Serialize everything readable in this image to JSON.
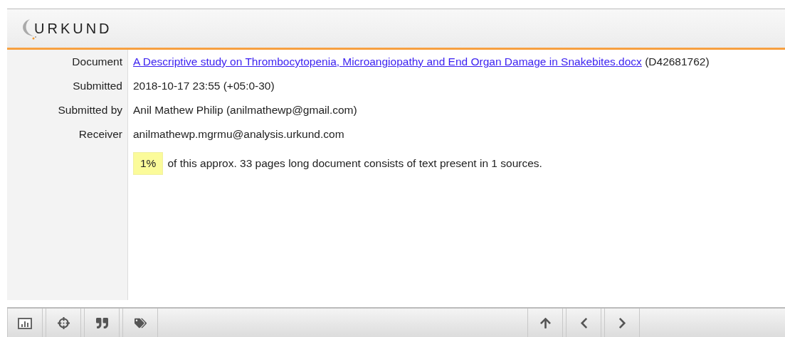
{
  "logo": {
    "text": "URKUND"
  },
  "details": [
    {
      "label": "Document",
      "kind": "link",
      "link": "A Descriptive study on Thrombocytopenia, Microangiopathy and End Organ Damage in Snakebites.docx",
      "suffix": "(D42681762)"
    },
    {
      "label": "Submitted",
      "kind": "text",
      "value": "2018-10-17 23:55 (+05:0-30)"
    },
    {
      "label": "Submitted by",
      "kind": "text",
      "value": "Anil Mathew Philip (anilmathewp@gmail.com)"
    },
    {
      "label": "Receiver",
      "kind": "text",
      "value": "anilmathewp.mgrmu@analysis.urkund.com"
    }
  ],
  "summary": {
    "percent": "1%",
    "text": "of this approx. 33 pages long document consists of text present in 1 sources."
  }
}
